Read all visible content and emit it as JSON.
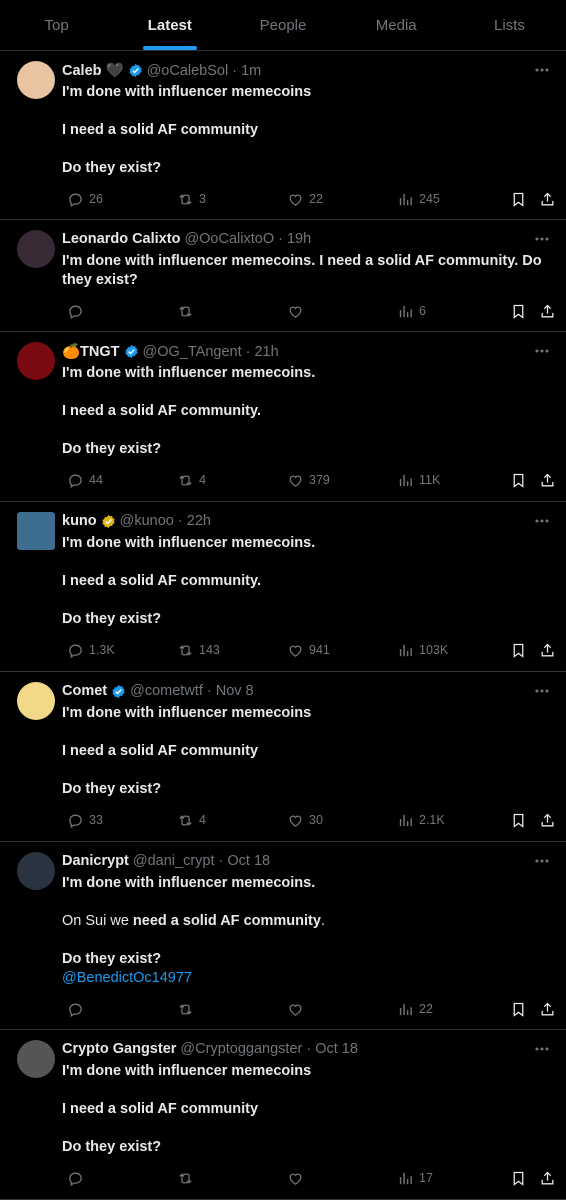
{
  "tabs": [
    {
      "label": "Top",
      "active": false
    },
    {
      "label": "Latest",
      "active": true
    },
    {
      "label": "People",
      "active": false
    },
    {
      "label": "Media",
      "active": false
    },
    {
      "label": "Lists",
      "active": false
    }
  ],
  "tweets": [
    {
      "name": "Caleb 🖤",
      "handle": "@oCalebSol · 1m",
      "verified": true,
      "avatar_color": "#e8c5a0",
      "avatar_shape": "round",
      "lines": [
        "I'm done with influencer memecoins",
        "",
        "I need a solid AF community",
        "",
        "Do they exist?"
      ],
      "replies": "26",
      "reposts": "3",
      "likes": "22",
      "views": "245"
    },
    {
      "name": "Leonardo Calixto",
      "handle": "@OoCalixtoO · 19h",
      "verified": false,
      "avatar_color": "#3a2a35",
      "avatar_shape": "round",
      "lines": [
        "I'm done with influencer memecoins.  I need a solid AF community.  Do they exist?"
      ],
      "replies": "",
      "reposts": "",
      "likes": "",
      "views": "6"
    },
    {
      "name": "🍊TNGT",
      "handle": "@OG_TAngent · 21h",
      "verified": true,
      "avatar_color": "#7a0a12",
      "avatar_shape": "round",
      "lines": [
        "I'm done with influencer memecoins.",
        "",
        "I need a solid AF community.",
        "",
        "Do they exist?"
      ],
      "replies": "44",
      "reposts": "4",
      "likes": "379",
      "views": "11K"
    },
    {
      "name": "kuno",
      "handle": "@kunoo · 22h",
      "verified": true,
      "verified_gold": true,
      "avatar_color": "#3d6e8f",
      "avatar_shape": "square",
      "lines": [
        "I'm done with influencer memecoins.",
        "",
        "I need a solid AF community.",
        "",
        "Do they exist?"
      ],
      "replies": "1.3K",
      "reposts": "143",
      "likes": "941",
      "views": "103K"
    },
    {
      "name": "Comet",
      "handle": "@cometwtf · Nov 8",
      "verified": true,
      "avatar_color": "#f2d98a",
      "avatar_shape": "round",
      "lines": [
        "I'm done with influencer memecoins",
        "",
        "I need a solid AF community",
        "",
        "Do they exist?"
      ],
      "replies": "33",
      "reposts": "4",
      "likes": "30",
      "views": "2.1K"
    },
    {
      "name": "Danicrypt",
      "handle": "@dani_crypt · Oct 18",
      "verified": false,
      "avatar_color": "#2a3440",
      "avatar_shape": "round",
      "lines": [
        "I'm done with influencer memecoins.",
        "",
        "On Sui we |need a solid AF community|.",
        "",
        "Do they exist?",
        "@BenedictOc14977"
      ],
      "replies": "",
      "reposts": "",
      "likes": "",
      "views": "22"
    },
    {
      "name": "Crypto Gangster",
      "handle": "@Cryptoggangster · Oct 18",
      "verified": false,
      "avatar_color": "#555555",
      "avatar_shape": "round",
      "lines": [
        "I'm done with influencer memecoins",
        "",
        "I need a solid AF community",
        "",
        "Do they exist?"
      ],
      "replies": "",
      "reposts": "",
      "likes": "",
      "views": "17"
    }
  ],
  "colors": {
    "background": "#000000",
    "accent": "#1d9bf0",
    "muted": "#71767b",
    "text": "#e7e9ea",
    "divider": "#2f3336",
    "gold": "#e2b719"
  },
  "icons": {
    "reply": "reply-icon",
    "repost": "repost-icon",
    "like": "heart-icon",
    "views": "views-icon",
    "bookmark": "bookmark-icon",
    "share": "share-icon",
    "more": "more-icon",
    "verified": "verified-icon"
  }
}
